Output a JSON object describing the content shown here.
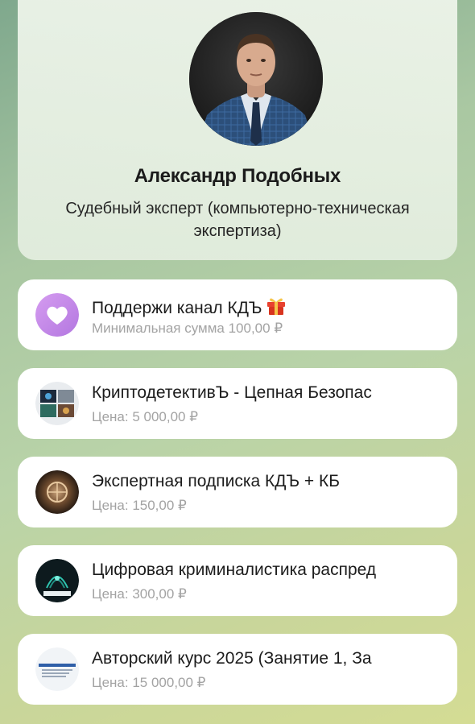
{
  "profile": {
    "name": "Александр Подобных",
    "title": "Судебный эксперт (компьютерно-техническая экспертиза)"
  },
  "colors": {
    "support_icon": "#c98be6",
    "subtitle_text": "#a3a3a3"
  },
  "items": [
    {
      "title": "Поддержи канал КДЪ",
      "emoji": "gift-icon",
      "subtitle": "Минимальная сумма 100,00 ₽",
      "icon": "heart-icon"
    },
    {
      "title": "КриптодетективЪ - Цепная Безопас",
      "subtitle": "Цена: 5 000,00 ₽",
      "icon": "product-thumbnail-crypto"
    },
    {
      "title": "Экспертная подписка КДЪ + КБ",
      "subtitle": "Цена: 150,00 ₽",
      "icon": "product-thumbnail-subscription"
    },
    {
      "title": "Цифровая криминалистика распред",
      "subtitle": "Цена: 300,00 ₽",
      "icon": "product-thumbnail-forensics"
    },
    {
      "title": "Авторский курс 2025 (Занятие 1, За",
      "subtitle": "Цена: 15 000,00 ₽",
      "icon": "product-thumbnail-course"
    }
  ]
}
